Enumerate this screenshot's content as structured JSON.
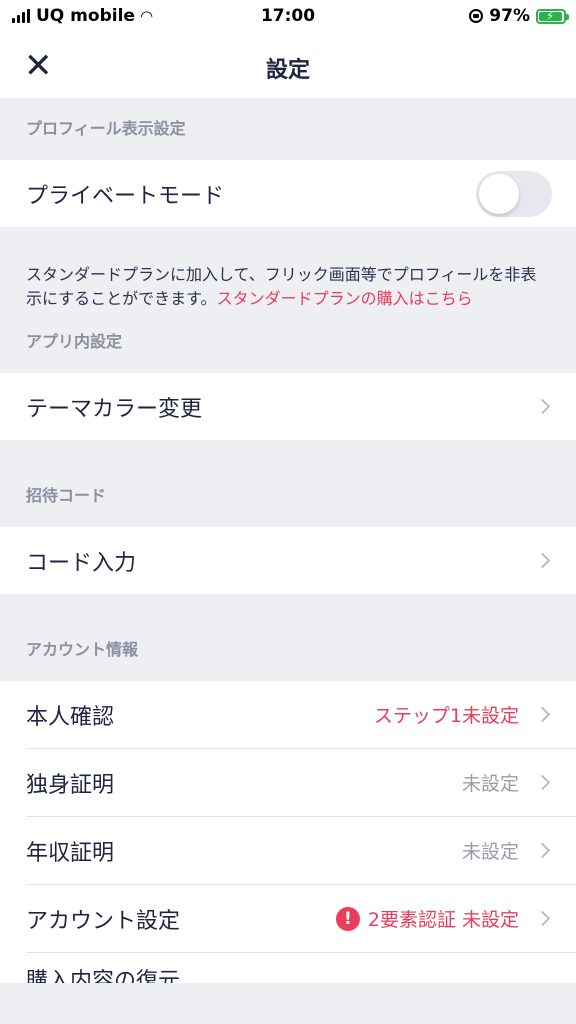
{
  "status": {
    "carrier": "UQ mobile",
    "time": "17:00",
    "battery": "97%"
  },
  "nav": {
    "title": "設定"
  },
  "sections": {
    "profile": {
      "header": "プロフィール表示設定",
      "private_mode": "プライベートモード",
      "note_text": "スタンダードプランに加入して、フリック画面等でプロフィールを非表示にすることができます。",
      "note_link": "スタンダードプランの購入はこちら"
    },
    "app": {
      "header": "アプリ内設定",
      "theme": "テーマカラー変更"
    },
    "invite": {
      "header": "招待コード",
      "code_input": "コード入力"
    },
    "account": {
      "header": "アカウント情報",
      "identity": {
        "label": "本人確認",
        "value": "ステップ1未設定"
      },
      "single": {
        "label": "独身証明",
        "value": "未設定"
      },
      "income": {
        "label": "年収証明",
        "value": "未設定"
      },
      "settings": {
        "label": "アカウント設定",
        "value": "2要素認証 未設定"
      },
      "restore": {
        "label": "購入内容の復元"
      }
    }
  },
  "colors": {
    "accent": "#ea3d5c",
    "text": "#1f2440",
    "background": "#eeeff3"
  }
}
